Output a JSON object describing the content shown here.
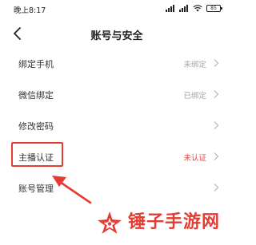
{
  "status_bar": {
    "time": "晚上8:17",
    "battery": "85"
  },
  "header": {
    "title": "账号与安全"
  },
  "settings": [
    {
      "label": "绑定手机",
      "value": "未绑定"
    },
    {
      "label": "微信绑定",
      "value": "已绑定"
    },
    {
      "label": "修改密码",
      "value": ""
    },
    {
      "label": "主播认证",
      "value": "未认证"
    },
    {
      "label": "账号管理",
      "value": ""
    }
  ],
  "colors": {
    "accent": "#e8453c",
    "muted_value": "#a6a6a6",
    "annotation": "#e63b32"
  },
  "watermark": {
    "text": "锤子手游网"
  }
}
